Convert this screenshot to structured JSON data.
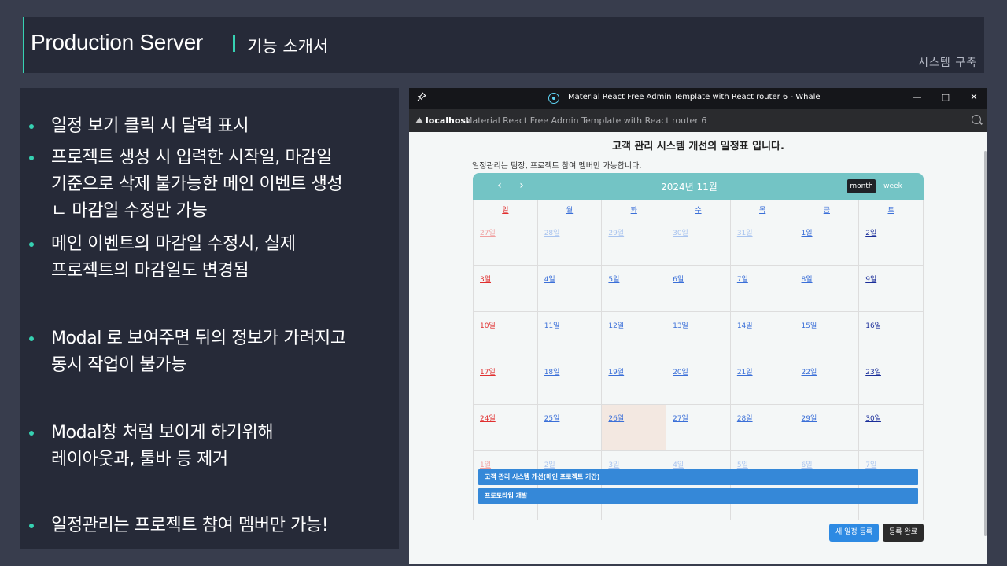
{
  "slide": {
    "title": "Production Server",
    "subtitle": "기능 소개서",
    "section": "시스템 구축",
    "accent_color": "#36d1b2"
  },
  "bullets": [
    {
      "lines": [
        "일정 보기 클릭 시 달력 표시"
      ]
    },
    {
      "lines": [
        "프로젝트 생성 시 입력한 시작일, 마감일",
        "기준으로 삭제 불가능한 메인 이벤트 생성",
        "ㄴ 마감일 수정만 가능"
      ]
    },
    {
      "lines": [
        "메인 이벤트의 마감일 수정시, 실제",
        "프로젝트의 마감일도 변경됨"
      ]
    },
    {
      "lines": [
        "Modal 로 보여주면 뒤의 정보가 가려지고",
        "동시 작업이 불가능"
      ]
    },
    {
      "lines": [
        "Modal창 처럼 보이게 하기위해",
        "레이아웃과, 툴바 등 제거"
      ]
    },
    {
      "lines": [
        "일정관리는 프로젝트 참여 멤버만 가능!"
      ]
    }
  ],
  "window": {
    "title": "Material React Free Admin Template with React router 6 - Whale",
    "address_host": "localhost",
    "address_page": "Material React Free Admin Template with React router 6",
    "controls": [
      "—",
      "□",
      "✕"
    ]
  },
  "page": {
    "heading": "고객 관리 시스템 개선의 일정표 입니다.",
    "subheading": "일정관리는 팀장, 프로젝트 참여 멤버만 가능합니다."
  },
  "calendar": {
    "title": "2024년 11월",
    "prev": "‹",
    "next": "›",
    "view_month": "month",
    "view_week": "week",
    "weekdays": [
      "일",
      "월",
      "화",
      "수",
      "목",
      "금",
      "토"
    ],
    "weeks": [
      [
        "27일",
        "28일",
        "29일",
        "30일",
        "31일",
        "1일",
        "2일"
      ],
      [
        "3일",
        "4일",
        "5일",
        "6일",
        "7일",
        "8일",
        "9일"
      ],
      [
        "10일",
        "11일",
        "12일",
        "13일",
        "14일",
        "15일",
        "16일"
      ],
      [
        "17일",
        "18일",
        "19일",
        "20일",
        "21일",
        "22일",
        "23일"
      ],
      [
        "24일",
        "25일",
        "26일",
        "27일",
        "28일",
        "29일",
        "30일"
      ],
      [
        "1일",
        "2일",
        "3일",
        "4일",
        "5일",
        "6일",
        "7일"
      ]
    ],
    "events": [
      {
        "label": "고객 관리 시스템 개선(메인 프로젝트 기간)",
        "color": "#3588d8"
      },
      {
        "label": "프로토타입 개발",
        "color": "#3588d8"
      }
    ]
  },
  "buttons": {
    "new_event": "새 일정 등록",
    "done": "등록 완료"
  }
}
